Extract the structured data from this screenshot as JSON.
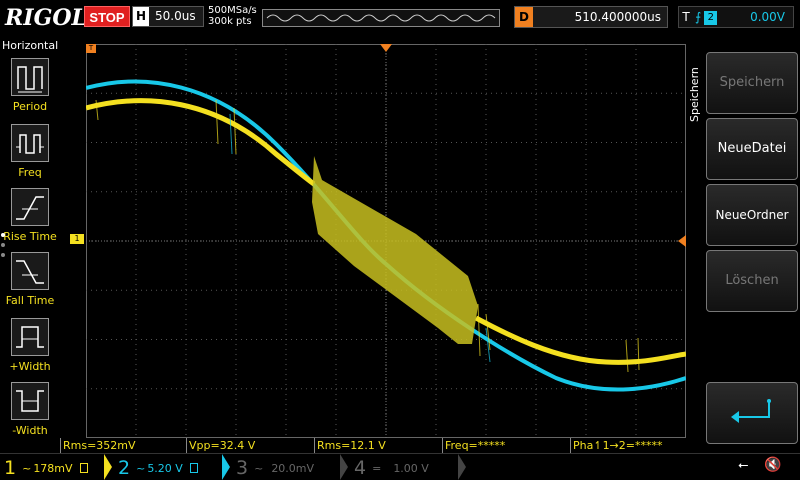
{
  "topbar": {
    "logo": "RIGOL",
    "run_state": "STOP",
    "horizontal_label": "H",
    "timebase": "50.0us",
    "sample_rate": "500MSa/s",
    "memory_depth": "300k pts",
    "delay_label": "D",
    "delay_value": "510.400000us",
    "trigger_label": "T",
    "trigger_edge_icon": "rising-edge-icon",
    "trigger_source": "2",
    "trigger_level": "0.00V"
  },
  "left_menu": {
    "title": "Horizontal",
    "items": [
      {
        "label": "Period",
        "icon": "period-icon"
      },
      {
        "label": "Freq",
        "icon": "frequency-icon"
      },
      {
        "label": "Rise Time",
        "icon": "rise-time-icon"
      },
      {
        "label": "Fall Time",
        "icon": "fall-time-icon"
      },
      {
        "label": "+Width",
        "icon": "positive-width-icon"
      },
      {
        "label": "-Width",
        "icon": "negative-width-icon"
      }
    ]
  },
  "right_menu": {
    "title": "Speichern",
    "buttons": [
      {
        "label": "Speichern",
        "enabled": false
      },
      {
        "label": "NeueDatei",
        "enabled": true
      },
      {
        "label": "NeueOrdner",
        "enabled": true
      },
      {
        "label": "Löschen",
        "enabled": false
      }
    ],
    "enter_icon": "enter-arrow-icon"
  },
  "measurements": [
    {
      "text": "Rms=352mV"
    },
    {
      "text": "Vpp=32.4 V"
    },
    {
      "text": "Rms=12.1 V"
    },
    {
      "text": "Freq=*****"
    },
    {
      "text": "Pha↿1→2=*****"
    }
  ],
  "channels": [
    {
      "num": "1",
      "value": "178mV",
      "coupling": "~",
      "color": "#f4e020"
    },
    {
      "num": "2",
      "value": "5.20 V",
      "coupling": "~",
      "color": "#18c8e8"
    },
    {
      "num": "3",
      "value": "20.0mV",
      "coupling": "~",
      "color": "#666666"
    },
    {
      "num": "4",
      "value": "1.00 V",
      "coupling": "=",
      "color": "#666666"
    }
  ],
  "colors": {
    "ch1": "#f4e020",
    "ch2": "#18c8e8",
    "stop": "#e02020",
    "delay": "#f08020"
  }
}
